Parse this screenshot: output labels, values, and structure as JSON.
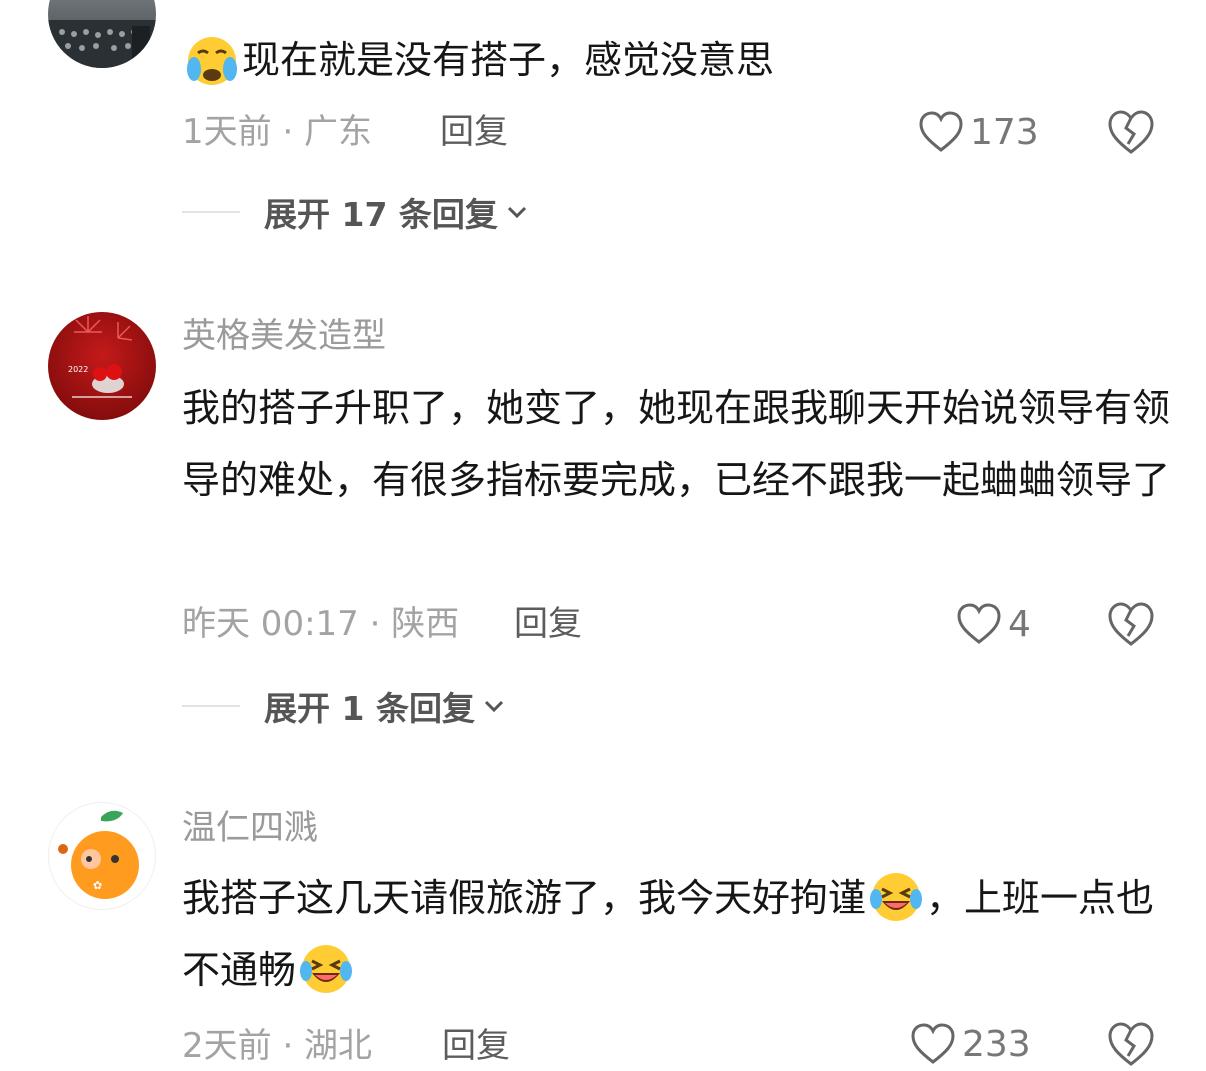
{
  "comments": [
    {
      "username": "",
      "text_parts": [
        "",
        "现在就是没有搭子，感觉没意思"
      ],
      "time_location": "1天前 · 广东",
      "reply_label": "回复",
      "likes": "173",
      "expand_label": "展开 17 条回复"
    },
    {
      "username": "英格美发造型",
      "text_parts": [
        "我的搭子升职了，她变了，她现在跟我聊天开始说领导有领导的难处，有很多指标要完成，已经不跟我一起蛐蛐领导了"
      ],
      "time_location": "昨天 00:17 · 陕西",
      "reply_label": "回复",
      "likes": "4",
      "expand_label": "展开 1 条回复",
      "avatar_caption": "2022"
    },
    {
      "username": "温仁四溅",
      "text_parts": [
        "我搭子这几天请假旅游了，我今天好拘谨",
        "，上班一点也不通畅",
        ""
      ],
      "time_location": "2天前 · 湖北",
      "reply_label": "回复",
      "likes": "233"
    }
  ],
  "icons": {
    "like": "heart-outline-icon",
    "dislike": "broken-heart-icon",
    "expand": "chevron-down-icon",
    "emoji_cry": "crying-face-emoji",
    "emoji_laugh": "laughing-crying-emoji"
  },
  "colors": {
    "text": "#161616",
    "muted": "#a3a3a3",
    "username": "#9a9a9a"
  }
}
